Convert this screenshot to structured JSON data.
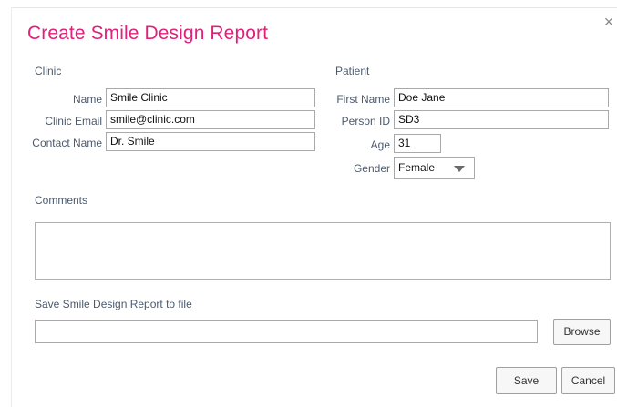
{
  "dialog": {
    "title": "Create Smile Design Report",
    "close_symbol": "×"
  },
  "clinic": {
    "section_label": "Clinic",
    "name_label": "Name",
    "name_value": "Smile Clinic",
    "email_label": "Clinic Email",
    "email_value": "smile@clinic.com",
    "contact_label": "Contact Name",
    "contact_value": "Dr. Smile"
  },
  "patient": {
    "section_label": "Patient",
    "first_name_label": "First Name",
    "first_name_value": "Doe Jane",
    "person_id_label": "Person ID",
    "person_id_value": "SD3",
    "age_label": "Age",
    "age_value": "31",
    "gender_label": "Gender",
    "gender_value": "Female"
  },
  "comments": {
    "label": "Comments",
    "value": ""
  },
  "save_file": {
    "label": "Save Smile Design Report to file",
    "path_value": "",
    "browse_label": "Browse"
  },
  "actions": {
    "save_label": "Save",
    "cancel_label": "Cancel"
  },
  "colors": {
    "title": "#e0217a",
    "label": "#4c5a6e"
  }
}
